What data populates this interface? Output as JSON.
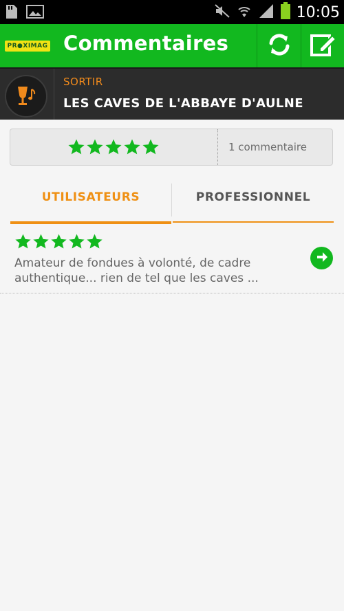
{
  "status_bar": {
    "time": "10:05",
    "icons": [
      "sd-card-icon",
      "image-icon",
      "mute-icon",
      "wifi-icon",
      "signal-icon",
      "battery-icon"
    ]
  },
  "action_bar": {
    "logo_text": "PR●XIMAG",
    "title": "Commentaires",
    "refresh_icon": "refresh-icon",
    "compose_icon": "compose-icon"
  },
  "venue": {
    "category": "SORTIR",
    "name": "LES CAVES DE L'ABBAYE D'AULNE",
    "icon": "wine-glass-music-icon"
  },
  "summary": {
    "rating_stars": 5,
    "rating_max": 5,
    "comment_count": "1 commentaire"
  },
  "tabs": [
    {
      "label": "UTILISATEURS",
      "active": true
    },
    {
      "label": "PROFESSIONNEL",
      "active": false
    }
  ],
  "comments": [
    {
      "rating_stars": 5,
      "text": "Amateur de fondues à volonté, de cadre authentique... rien de tel que les caves ..."
    }
  ],
  "colors": {
    "action_bar": "#12b81f",
    "accent_orange": "#ef9014",
    "star_green": "#12b81f",
    "venue_bar": "#2c2c2c"
  }
}
